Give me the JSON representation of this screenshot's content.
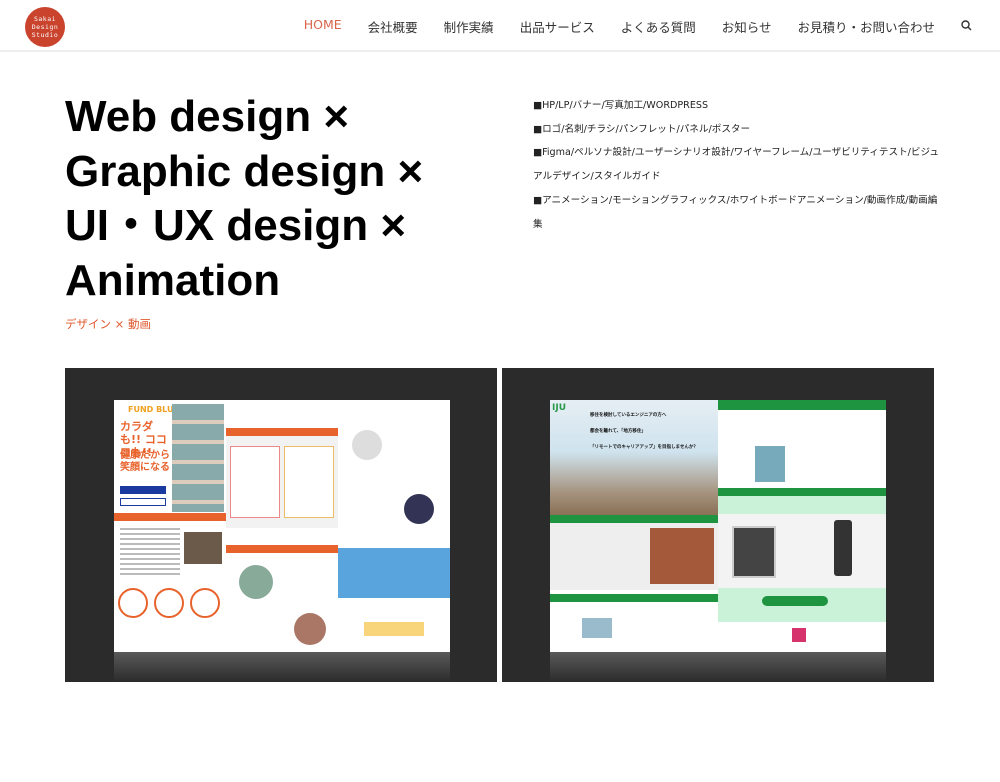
{
  "logo": {
    "text": [
      "Sakai",
      "Design",
      "Studio"
    ],
    "color": "#c9432d"
  },
  "nav": {
    "items": [
      "HOME",
      "会社概要",
      "制作実績",
      "出品サービス",
      "よくある質問",
      "お知らせ",
      "お見積り・お問い合わせ"
    ],
    "active": "HOME",
    "search_icon": "search-icon",
    "accent": "#d9654a"
  },
  "hero": {
    "headline": [
      "Web design ×",
      "Graphic design ×",
      "UI・UX design ×",
      "Animation"
    ],
    "subtitle": "デザイン × 動画",
    "skills": [
      "■HP/LP/バナー/写真加工/WORDPRESS",
      "■ロゴ/名刺/チラシ/パンフレット/パネル/ポスター",
      "■Figma/ペルソナ設計/ユーザーシナリオ設計/ワイヤーフレーム/ユーザビリティテスト/ビジュアルデザイン/スタイルガイド",
      "■アニメーション/モーショングラフィックス/ホワイトボードアニメーション/動画作成/動画編集"
    ]
  },
  "gallery": {
    "left": {
      "brand": "FUND BLUE",
      "copy1": "カラダも!! ココロも!!",
      "copy2": "健康だから 笑顔になる"
    },
    "right": {
      "logo": "IJU",
      "line1": "移住を検討しているエンジニアの方へ",
      "line2": "都会を離れて、「地方移住」",
      "line3": "「リモートでのキャリアアップ」を目指しませんか？"
    }
  }
}
